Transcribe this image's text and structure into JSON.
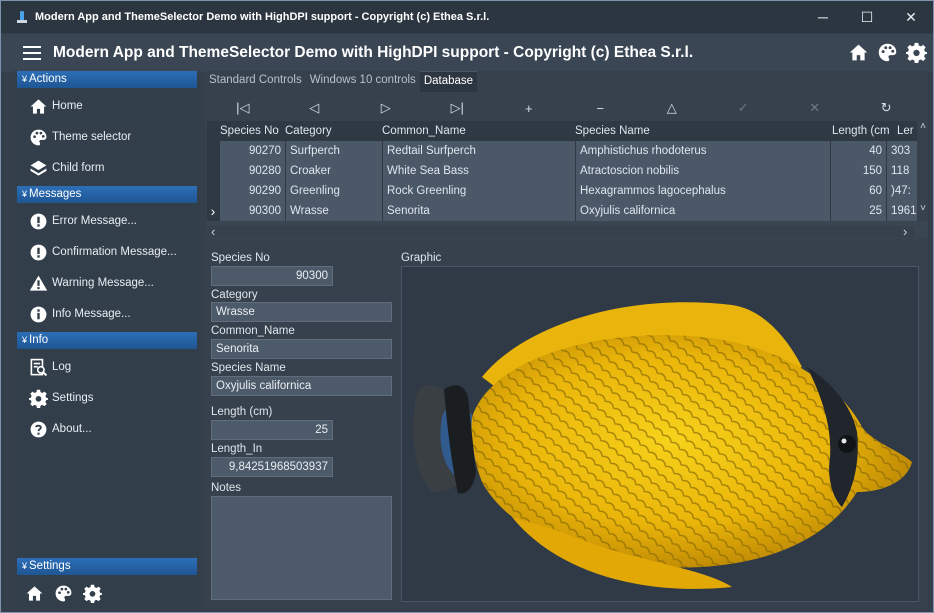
{
  "window": {
    "title": "Modern App and ThemeSelector Demo with HighDPI support - Copyright (c) Ethea S.r.l.",
    "minimize": "─",
    "maximize": "☐",
    "close": "✕"
  },
  "header": {
    "caption": "Modern App and ThemeSelector Demo with HighDPI support - Copyright (c) Ethea S.r.l.",
    "icons": [
      "home-icon",
      "palette-icon",
      "gear-icon"
    ]
  },
  "sidebar": {
    "groups": [
      {
        "label": "Actions",
        "items": [
          {
            "label": "Home",
            "icon": "home-icon"
          },
          {
            "label": "Theme selector",
            "icon": "palette-icon"
          },
          {
            "label": "Child form",
            "icon": "layers-icon"
          }
        ]
      },
      {
        "label": "Messages",
        "items": [
          {
            "label": "Error Message...",
            "icon": "error-icon"
          },
          {
            "label": "Confirmation Message...",
            "icon": "question-icon"
          },
          {
            "label": "Warning Message...",
            "icon": "warning-icon"
          },
          {
            "label": "Info Message...",
            "icon": "info-icon"
          }
        ]
      },
      {
        "label": "Info",
        "items": [
          {
            "label": "Log",
            "icon": "log-icon"
          },
          {
            "label": "Settings",
            "icon": "gear-icon"
          },
          {
            "label": "About...",
            "icon": "help-icon"
          }
        ]
      },
      {
        "label": "Settings",
        "items": []
      }
    ],
    "bottom_icons": [
      "home-icon",
      "palette-icon",
      "gear-icon"
    ]
  },
  "tabs": [
    "Standard Controls",
    "Windows 10 controls",
    "Database"
  ],
  "active_tab": "Database",
  "navigator": {
    "buttons": [
      {
        "name": "first",
        "glyph": "|◁"
      },
      {
        "name": "prior",
        "glyph": "◁"
      },
      {
        "name": "next",
        "glyph": "▷"
      },
      {
        "name": "last",
        "glyph": "▷|"
      },
      {
        "name": "insert",
        "glyph": "+"
      },
      {
        "name": "delete",
        "glyph": "−"
      },
      {
        "name": "edit",
        "glyph": "△"
      },
      {
        "name": "post",
        "glyph": "✓"
      },
      {
        "name": "cancel",
        "glyph": "✕"
      },
      {
        "name": "refresh",
        "glyph": "↻"
      }
    ]
  },
  "grid": {
    "columns": [
      "Species No",
      "Category",
      "Common_Name",
      "Species Name",
      "Length (cm",
      "Ler"
    ],
    "rows": [
      [
        "90270",
        "Surfperch",
        "Redtail Surfperch",
        "Amphistichus rhodoterus",
        "40",
        "303"
      ],
      [
        "90280",
        "Croaker",
        "White Sea Bass",
        "Atractoscion nobilis",
        "150",
        "118"
      ],
      [
        "90290",
        "Greenling",
        "Rock Greenling",
        "Hexagrammos lagocephalus",
        "60",
        ")47:"
      ],
      [
        "90300",
        "Wrasse",
        "Senorita",
        "Oxyjulis californica",
        "25",
        "1961"
      ]
    ],
    "current_row_marker": "›",
    "scroll_left": "‹",
    "scroll_right": "›",
    "scroll_up": "˄",
    "scroll_down": "˅"
  },
  "form": {
    "species_no": {
      "label": "Species No",
      "value": "90300"
    },
    "category": {
      "label": "Category",
      "value": "Wrasse"
    },
    "common_name": {
      "label": "Common_Name",
      "value": "Senorita"
    },
    "species_name": {
      "label": "Species Name",
      "value": "Oxyjulis californica"
    },
    "length_cm": {
      "label": "Length (cm)",
      "value": "25"
    },
    "length_in": {
      "label": "Length_In",
      "value": "9,84251968503937"
    },
    "notes": {
      "label": "Notes",
      "value": ""
    },
    "graphic": {
      "label": "Graphic"
    }
  },
  "colors": {
    "accent": "#2c6fb7",
    "background": "#343f4b",
    "fish_yellow": "#f2c30c"
  }
}
